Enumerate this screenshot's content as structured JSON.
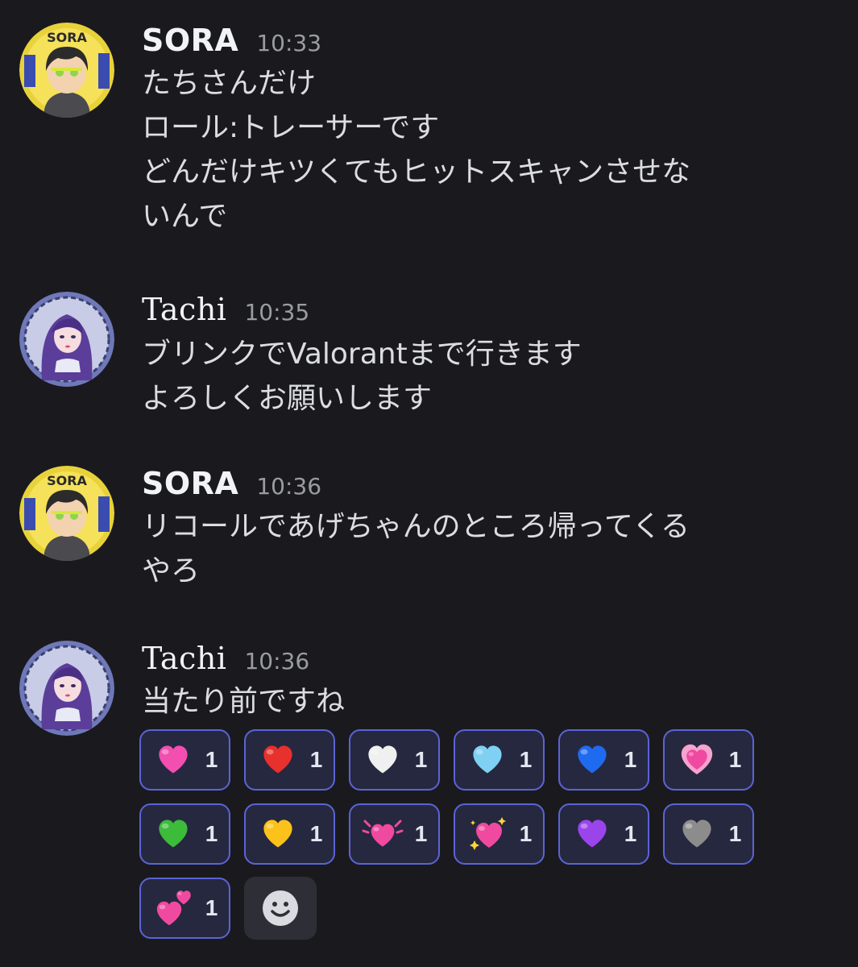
{
  "messages": [
    {
      "author": "SORA",
      "time": "10:33",
      "lines": [
        "たちさんだけ",
        "ロール:トレーサーです",
        "どんだけキツくてもヒットスキャンさせな",
        "いんで"
      ]
    },
    {
      "author": "Tachi",
      "time": "10:35",
      "lines": [
        "ブリンクでValorantまで行きます",
        "よろしくお願いします"
      ]
    },
    {
      "author": "SORA",
      "time": "10:36",
      "lines": [
        "リコールであげちゃんのところ帰ってくる",
        "やろ"
      ]
    },
    {
      "author": "Tachi",
      "time": "10:36",
      "lines": [
        "当たり前ですね"
      ]
    }
  ],
  "avatars": {
    "sora_badge_text": "SORA"
  },
  "reactions": [
    {
      "emoji": "pink-heart-icon",
      "color": "#f24fb1",
      "count": "1"
    },
    {
      "emoji": "red-heart-icon",
      "color": "#e8302c",
      "count": "1"
    },
    {
      "emoji": "white-heart-icon",
      "color": "#f0f0f0",
      "count": "1"
    },
    {
      "emoji": "light-blue-heart-icon",
      "color": "#7fd0f2",
      "count": "1"
    },
    {
      "emoji": "blue-heart-icon",
      "color": "#1f6bf0",
      "count": "1"
    },
    {
      "emoji": "growing-heart-icon",
      "color": "#f04aa0",
      "count": "1"
    },
    {
      "emoji": "green-heart-icon",
      "color": "#3dbb3a",
      "count": "1"
    },
    {
      "emoji": "yellow-heart-icon",
      "color": "#fcc21b",
      "count": "1"
    },
    {
      "emoji": "beating-heart-icon",
      "color": "#f04aa0",
      "count": "1"
    },
    {
      "emoji": "sparkling-heart-icon",
      "color": "#f04aa0",
      "count": "1"
    },
    {
      "emoji": "purple-heart-icon",
      "color": "#9b44ec",
      "count": "1"
    },
    {
      "emoji": "grey-heart-icon",
      "color": "#8c8c8c",
      "count": "1"
    },
    {
      "emoji": "two-hearts-icon",
      "color": "#f04aa0",
      "count": "1"
    }
  ]
}
